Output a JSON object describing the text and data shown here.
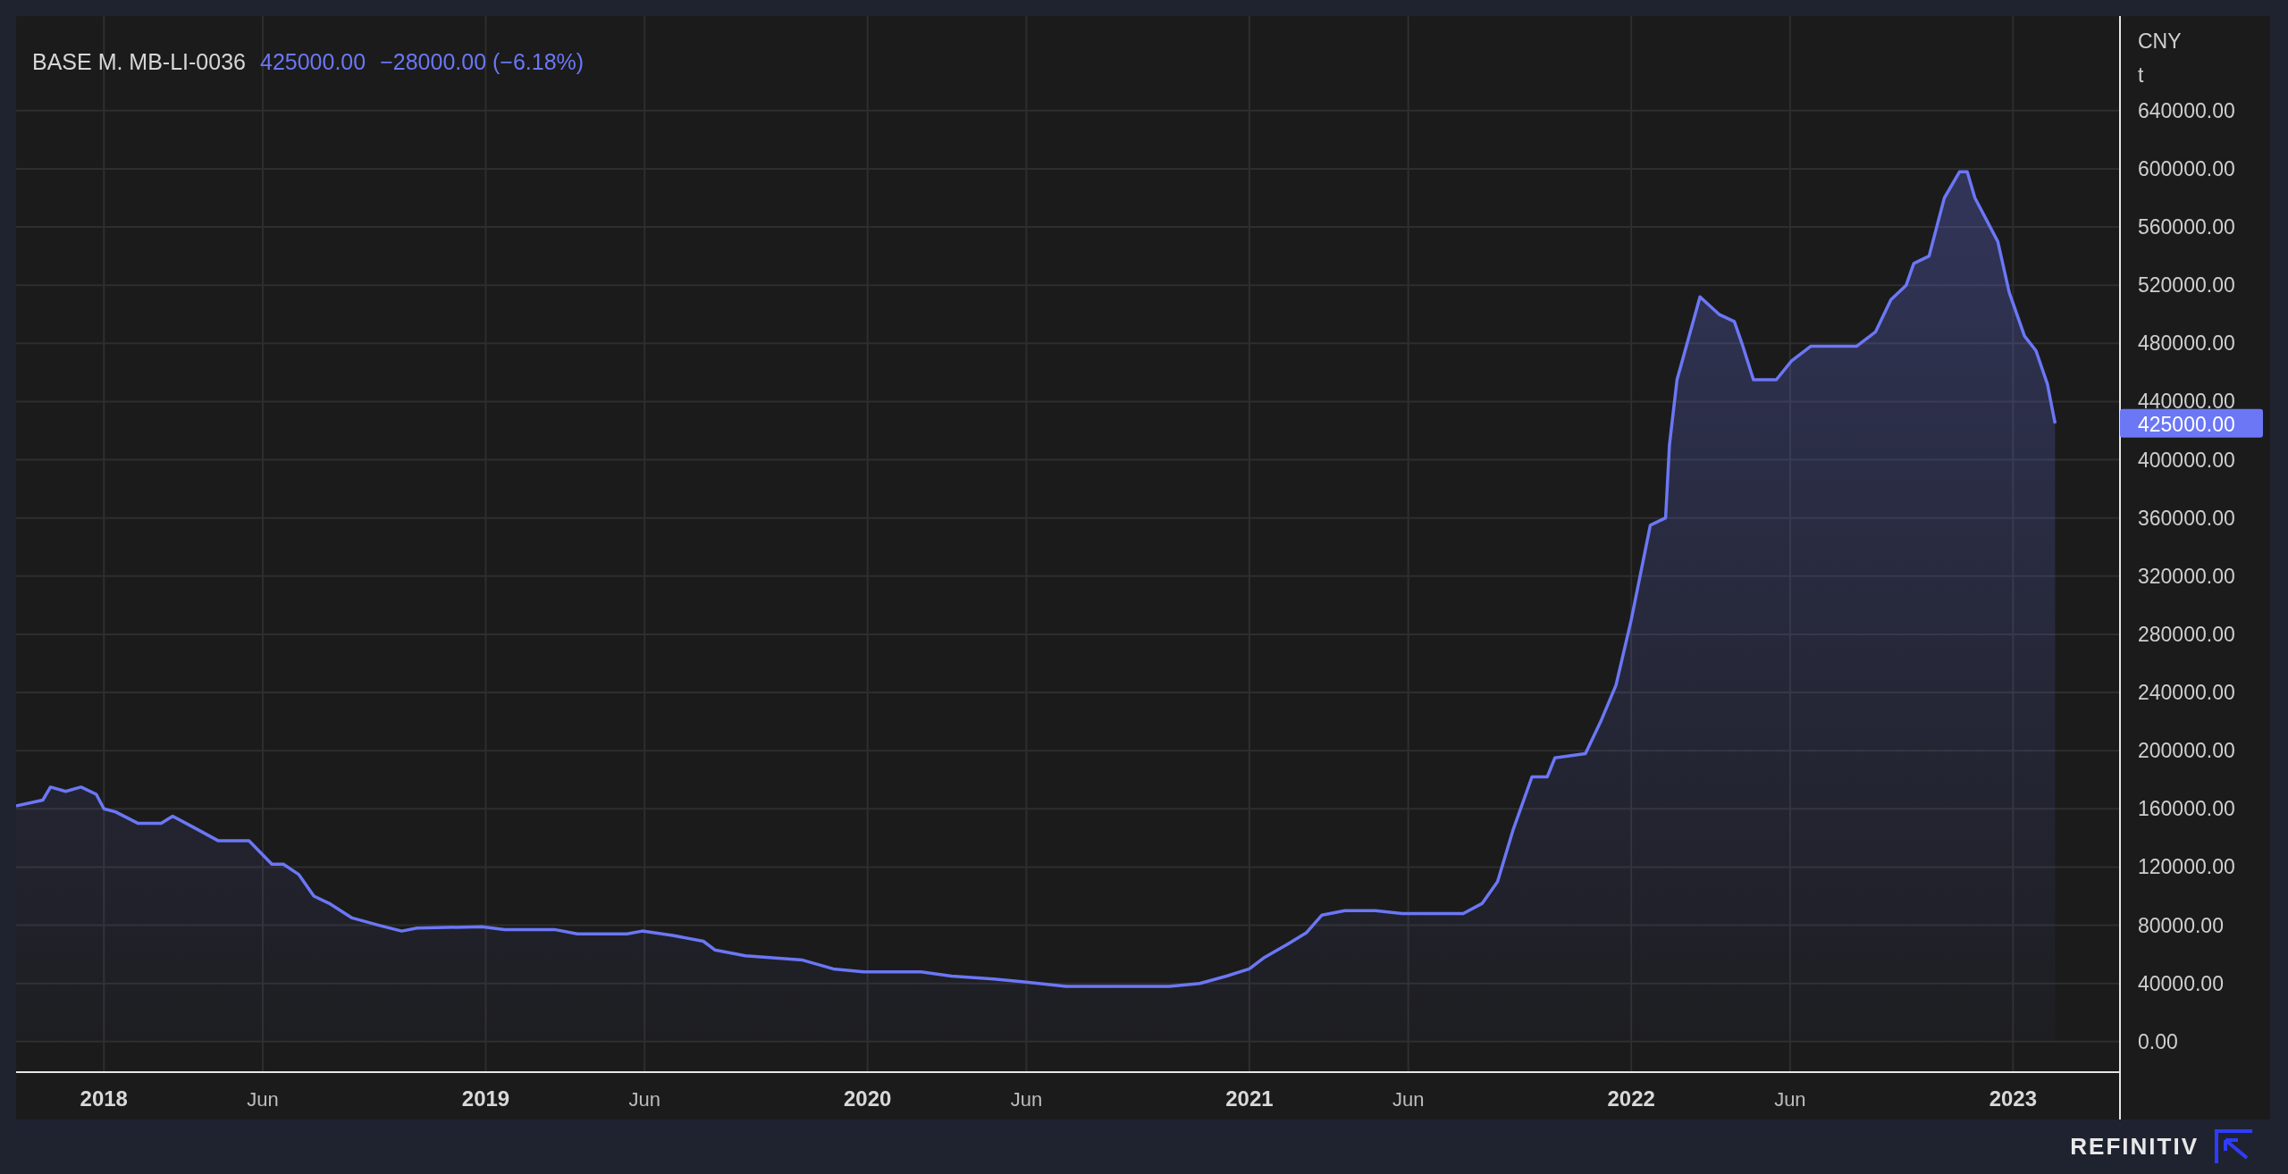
{
  "legend": {
    "last": "425000.00",
    "change": "−28000.00 (−6.18%)"
  },
  "price_tag": "425000.00",
  "units": [
    "CNY",
    "t"
  ],
  "chart_data": {
    "type": "area",
    "x": [
      2017.77,
      2017.84,
      2017.86,
      2017.9,
      2017.94,
      2017.98,
      2018.0,
      2018.03,
      2018.09,
      2018.15,
      2018.18,
      2018.23,
      2018.3,
      2018.38,
      2018.44,
      2018.47,
      2018.51,
      2018.55,
      2018.59,
      2018.65,
      2018.72,
      2018.78,
      2018.82,
      2018.99,
      2019.05,
      2019.18,
      2019.24,
      2019.37,
      2019.41,
      2019.49,
      2019.57,
      2019.6,
      2019.68,
      2019.83,
      2019.91,
      2019.99,
      2020.14,
      2020.22,
      2020.33,
      2020.41,
      2020.52,
      2020.79,
      2020.87,
      2020.94,
      2021.0,
      2021.04,
      2021.1,
      2021.15,
      2021.19,
      2021.25,
      2021.33,
      2021.4,
      2021.56,
      2021.61,
      2021.65,
      2021.69,
      2021.74,
      2021.78,
      2021.8,
      2021.88,
      2021.92,
      2021.96,
      2022.0,
      2022.05,
      2022.09,
      2022.1,
      2022.12,
      2022.18,
      2022.23,
      2022.27,
      2022.29,
      2022.32,
      2022.38,
      2022.42,
      2022.47,
      2022.59,
      2022.64,
      2022.68,
      2022.72,
      2022.74,
      2022.78,
      2022.82,
      2022.86,
      2022.88,
      2022.9,
      2022.93,
      2022.96,
      2022.99,
      2023.03,
      2023.06,
      2023.09,
      2023.11
    ],
    "series": [
      {
        "name": "BASE M. MB-LI-0036",
        "color": "#6b77f5",
        "values": [
          162000,
          166000,
          175000,
          172000,
          175000,
          170000,
          160000,
          158000,
          150000,
          150000,
          155000,
          148000,
          138000,
          138000,
          122000,
          122000,
          115000,
          100000,
          95000,
          85000,
          80000,
          76000,
          78000,
          79000,
          77000,
          77000,
          74000,
          74000,
          76000,
          73000,
          69000,
          63000,
          59000,
          56000,
          50000,
          48000,
          48000,
          45000,
          43000,
          41000,
          38000,
          38000,
          40000,
          45000,
          50000,
          58000,
          67000,
          75000,
          87000,
          90000,
          90000,
          88000,
          88000,
          95000,
          110000,
          145000,
          182000,
          182000,
          195000,
          198000,
          220000,
          245000,
          290000,
          355000,
          360000,
          410000,
          455000,
          512000,
          500000,
          495000,
          480000,
          455000,
          455000,
          468000,
          478000,
          478000,
          488000,
          510000,
          520000,
          535000,
          540000,
          580000,
          598000,
          598000,
          580000,
          565000,
          550000,
          515000,
          485000,
          475000,
          452000,
          425000
        ]
      }
    ],
    "grid": true,
    "xlim": [
      2017.77,
      2023.28
    ],
    "ylim": [
      -21000,
      705000
    ],
    "xticks": [
      {
        "value": 2018,
        "label": "2018"
      },
      {
        "value": 2018.416,
        "label": "Jun"
      },
      {
        "value": 2019,
        "label": "2019"
      },
      {
        "value": 2019.416,
        "label": "Jun"
      },
      {
        "value": 2020,
        "label": "2020"
      },
      {
        "value": 2020.416,
        "label": "Jun"
      },
      {
        "value": 2021,
        "label": "2021"
      },
      {
        "value": 2021.416,
        "label": "Jun"
      },
      {
        "value": 2022,
        "label": "2022"
      },
      {
        "value": 2022.416,
        "label": "Jun"
      },
      {
        "value": 2023,
        "label": "2023"
      }
    ],
    "yticks": [
      {
        "value": 0,
        "label": "0.00"
      },
      {
        "value": 40000,
        "label": "40000.00"
      },
      {
        "value": 80000,
        "label": "80000.00"
      },
      {
        "value": 120000,
        "label": "120000.00"
      },
      {
        "value": 160000,
        "label": "160000.00"
      },
      {
        "value": 200000,
        "label": "200000.00"
      },
      {
        "value": 240000,
        "label": "240000.00"
      },
      {
        "value": 280000,
        "label": "280000.00"
      },
      {
        "value": 320000,
        "label": "320000.00"
      },
      {
        "value": 360000,
        "label": "360000.00"
      },
      {
        "value": 400000,
        "label": "400000.00"
      },
      {
        "value": 440000,
        "label": "440000.00"
      },
      {
        "value": 480000,
        "label": "480000.00"
      },
      {
        "value": 520000,
        "label": "520000.00"
      },
      {
        "value": 560000,
        "label": "560000.00"
      },
      {
        "value": 600000,
        "label": "600000.00"
      },
      {
        "value": 640000,
        "label": "640000.00"
      }
    ]
  },
  "brand": "REFINITIV"
}
